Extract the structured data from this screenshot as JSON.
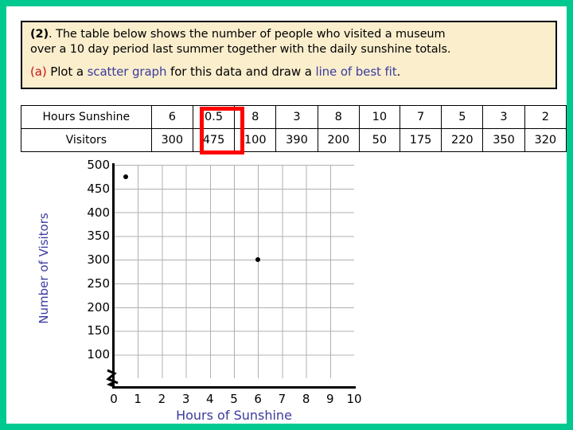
{
  "theme": {
    "frame_color": "#00c98f",
    "question_bg": "#faeecd",
    "accent_red": "#cc1111",
    "accent_blue": "#3b3b9e",
    "highlight_red": "#ff0000"
  },
  "question": {
    "number": "(2)",
    "line1_after_number": ". The table below shows the number of people who visited a museum",
    "line2": "over a 10 day period last summer together with the daily sunshine totals.",
    "part_label": "(a)",
    "part_text_1": " Plot a ",
    "part_highlight_1": "scatter graph",
    "part_text_2": " for this data and draw a ",
    "part_highlight_2": "line of best fit",
    "part_text_3": "."
  },
  "table": {
    "row_labels": [
      "Hours Sunshine",
      "Visitors"
    ],
    "hours_sunshine": [
      "6",
      "0.5",
      "8",
      "3",
      "8",
      "10",
      "7",
      "5",
      "3",
      "2"
    ],
    "visitors": [
      "300",
      "475",
      "100",
      "390",
      "200",
      "50",
      "175",
      "220",
      "350",
      "320"
    ],
    "highlighted_column_index": 1
  },
  "chart_data": {
    "type": "scatter",
    "title": "",
    "xlabel": "Hours of Sunshine",
    "ylabel": "Number of Visitors",
    "xlim": [
      0,
      10
    ],
    "ylim": [
      50,
      500
    ],
    "xticks": [
      "0",
      "1",
      "2",
      "3",
      "4",
      "5",
      "6",
      "7",
      "8",
      "9",
      "10"
    ],
    "yticks": [
      "500",
      "450",
      "400",
      "350",
      "300",
      "250",
      "200",
      "150",
      "100"
    ],
    "grid": true,
    "y_axis_break": true,
    "legend": "none",
    "x": [
      0.5,
      6
    ],
    "y": [
      475,
      300
    ],
    "points_plotted": [
      {
        "x": 0.5,
        "y": 475
      },
      {
        "x": 6,
        "y": 300
      }
    ],
    "full_dataset": {
      "x": [
        6,
        0.5,
        8,
        3,
        8,
        10,
        7,
        5,
        3,
        2
      ],
      "y": [
        300,
        475,
        100,
        390,
        200,
        50,
        175,
        220,
        350,
        320
      ]
    }
  }
}
